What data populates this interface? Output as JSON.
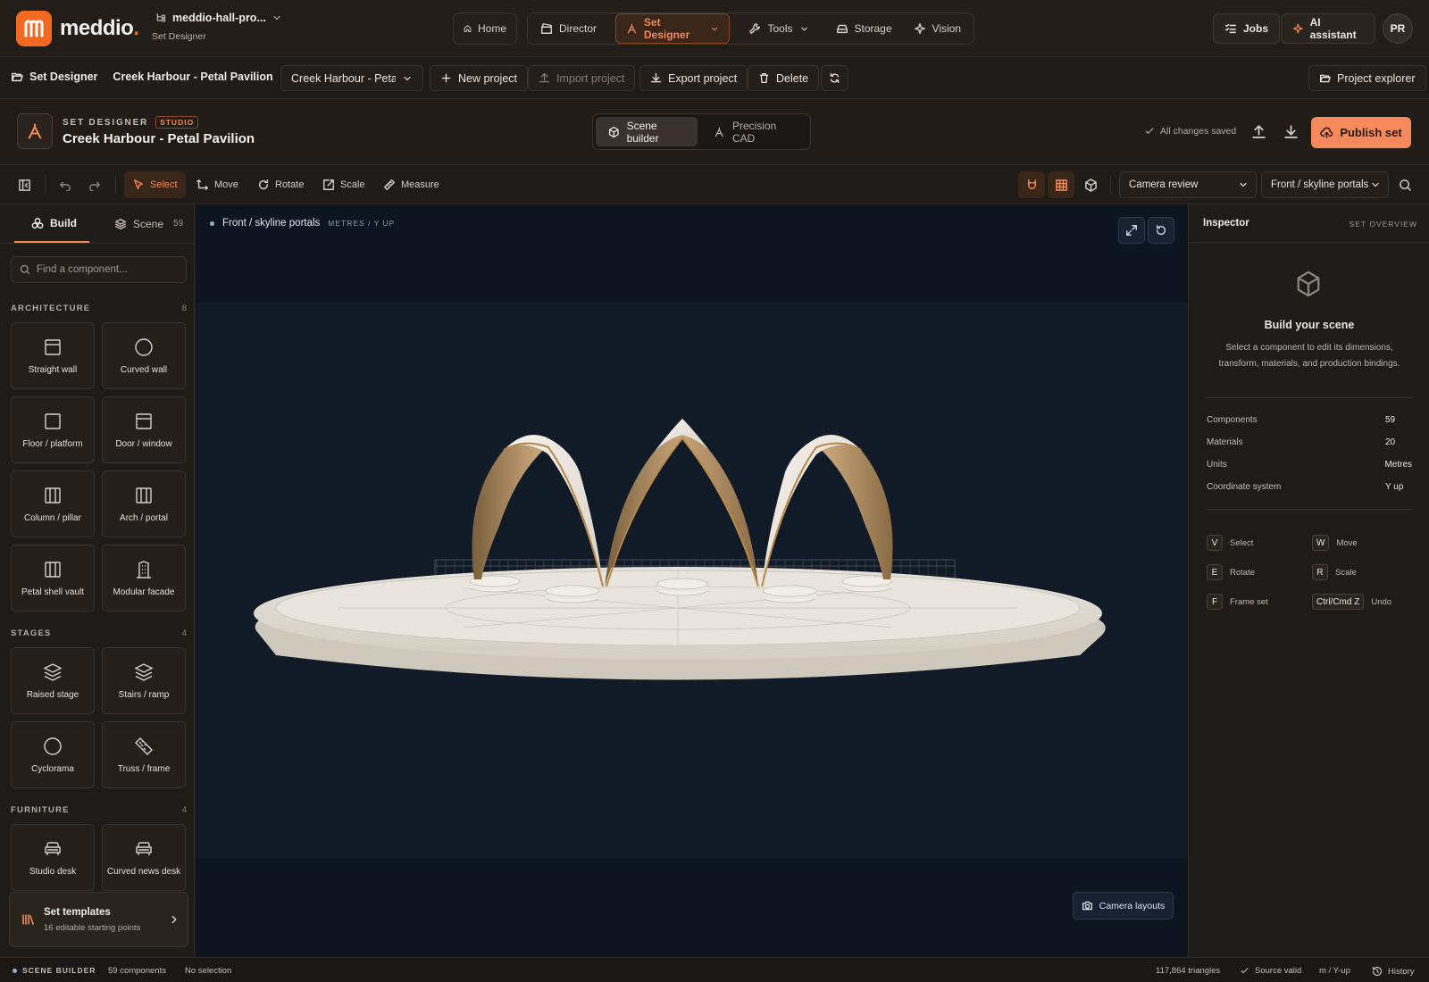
{
  "app": {
    "brand": "meddio",
    "brand_dot": ".",
    "project_short": "meddio-hall-pro...",
    "module": "Set Designer",
    "accent": "#f26a21"
  },
  "nav": {
    "home": "Home",
    "director": "Director",
    "set_designer": "Set Designer",
    "tools": "Tools",
    "storage": "Storage",
    "vision": "Vision",
    "jobs": "Jobs",
    "ai": "AI assistant",
    "avatar": "PR"
  },
  "projbar": {
    "section": "Set Designer",
    "project_name": "Creek Harbour - Petal Pavilion",
    "selected_project": "Creek Harbour - Petal Pavilion",
    "new": "New project",
    "import": "Import project",
    "export": "Export project",
    "delete": "Delete",
    "explorer": "Project explorer"
  },
  "header": {
    "kicker": "SET DESIGNER",
    "badge": "STUDIO",
    "title": "Creek Harbour - Petal Pavilion",
    "mode_scene": "Scene builder",
    "mode_cad": "Precision CAD",
    "saved": "All changes saved",
    "publish": "Publish set"
  },
  "toolbar": {
    "select": "Select",
    "move": "Move",
    "rotate": "Rotate",
    "scale": "Scale",
    "measure": "Measure",
    "camera_mode": "Camera review",
    "camera_view": "Front / skyline portals"
  },
  "left": {
    "tab_build": "Build",
    "tab_scene": "Scene",
    "scene_count": "59",
    "search_placeholder": "Find a component...",
    "sections": [
      {
        "title": "ARCHITECTURE",
        "count": "8",
        "items": [
          "Straight wall",
          "Curved wall",
          "Floor / platform",
          "Door / window",
          "Column / pillar",
          "Arch / portal",
          "Petal shell vault",
          "Modular facade"
        ]
      },
      {
        "title": "STAGES",
        "count": "4",
        "items": [
          "Raised stage",
          "Stairs / ramp",
          "Cyclorama",
          "Truss / frame"
        ]
      },
      {
        "title": "FURNITURE",
        "count": "4",
        "items": [
          "Studio desk",
          "Curved news desk"
        ]
      }
    ],
    "templates_title": "Set templates",
    "templates_sub": "16 editable starting points"
  },
  "viewport": {
    "view_name": "Front / skyline portals",
    "units": "METRES / Y UP",
    "camera_layouts": "Camera layouts"
  },
  "inspector": {
    "title": "Inspector",
    "subtitle": "SET OVERVIEW",
    "empty_title": "Build your scene",
    "empty_desc": "Select a component to edit its dimensions, transform, materials, and production bindings.",
    "stats": [
      {
        "k": "Components",
        "v": "59"
      },
      {
        "k": "Materials",
        "v": "20"
      },
      {
        "k": "Units",
        "v": "Metres"
      },
      {
        "k": "Coordinate system",
        "v": "Y up"
      }
    ],
    "shortcuts": [
      {
        "key": "V",
        "label": "Select"
      },
      {
        "key": "W",
        "label": "Move"
      },
      {
        "key": "E",
        "label": "Rotate"
      },
      {
        "key": "R",
        "label": "Scale"
      },
      {
        "key": "F",
        "label": "Frame set"
      },
      {
        "key": "Ctrl/Cmd Z",
        "label": "Undo"
      }
    ]
  },
  "status": {
    "mode": "SCENE BUILDER",
    "components": "59 components",
    "selection": "No selection",
    "triangles": "117,864 triangles",
    "valid": "Source valid",
    "units": "m / Y-up",
    "history": "History"
  }
}
